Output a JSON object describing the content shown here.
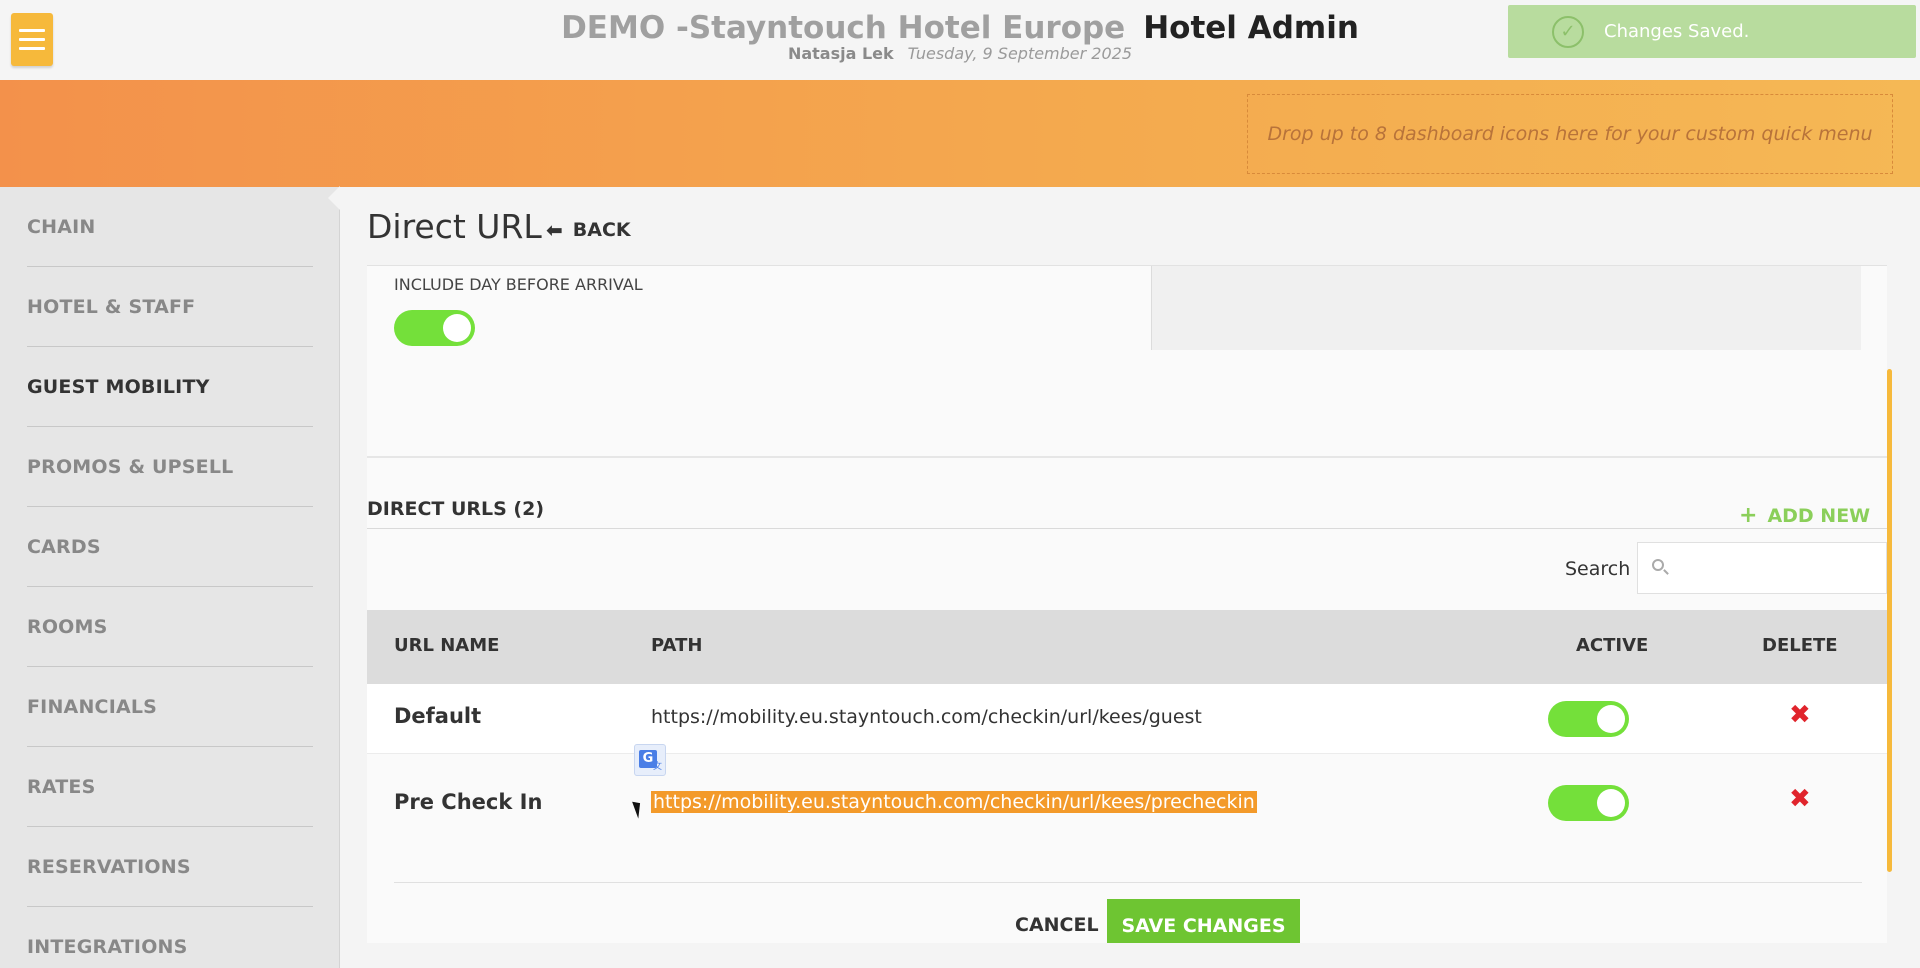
{
  "header": {
    "hotel_name": "DEMO -Stayntouch Hotel Europe",
    "app_name": "Hotel Admin",
    "user": "Natasja Lek",
    "date": "Tuesday, 9 September 2025"
  },
  "toast": {
    "message": "Changes Saved."
  },
  "quick_menu": {
    "placeholder": "Drop up to 8 dashboard icons here for your custom quick menu"
  },
  "sidebar": {
    "items": [
      {
        "label": "CHAIN",
        "active": false
      },
      {
        "label": "HOTEL & STAFF",
        "active": false
      },
      {
        "label": "GUEST MOBILITY",
        "active": true
      },
      {
        "label": "PROMOS & UPSELL",
        "active": false
      },
      {
        "label": "CARDS",
        "active": false
      },
      {
        "label": "ROOMS",
        "active": false
      },
      {
        "label": "FINANCIALS",
        "active": false
      },
      {
        "label": "RATES",
        "active": false
      },
      {
        "label": "RESERVATIONS",
        "active": false
      },
      {
        "label": "INTEGRATIONS",
        "active": false
      }
    ]
  },
  "page": {
    "title": "Direct URL",
    "back_label": "BACK"
  },
  "settings": {
    "include_day_before_arrival_label": "INCLUDE DAY BEFORE ARRIVAL",
    "include_day_before_arrival": true
  },
  "direct_urls": {
    "heading": "DIRECT URLS (2)",
    "add_new_label": "ADD NEW",
    "search_label": "Search",
    "search_value": "",
    "columns": {
      "url_name": "URL NAME",
      "path": "PATH",
      "active": "ACTIVE",
      "delete": "DELETE"
    },
    "rows": [
      {
        "name": "Default",
        "path": "https://mobility.eu.stayntouch.com/checkin/url/kees/guest",
        "active": true
      },
      {
        "name": "Pre Check In",
        "path": "https://mobility.eu.stayntouch.com/checkin/url/kees/precheckin",
        "active": true
      }
    ]
  },
  "actions": {
    "cancel_label": "CANCEL",
    "save_label": "SAVE CHANGES"
  },
  "icons": {
    "menu": "hamburger-icon",
    "toast": "check-circle-icon",
    "back": "arrow-left-icon",
    "add": "plus-icon",
    "search": "search-icon",
    "delete": "close-x-icon",
    "translate": "google-translate-icon"
  },
  "colors": {
    "accent": "#f6b93b",
    "toggle_on": "#74e03a",
    "add_new": "#8bcf5a",
    "save": "#6ec532",
    "delete": "#e0242c",
    "selection": "#f39a2a"
  }
}
